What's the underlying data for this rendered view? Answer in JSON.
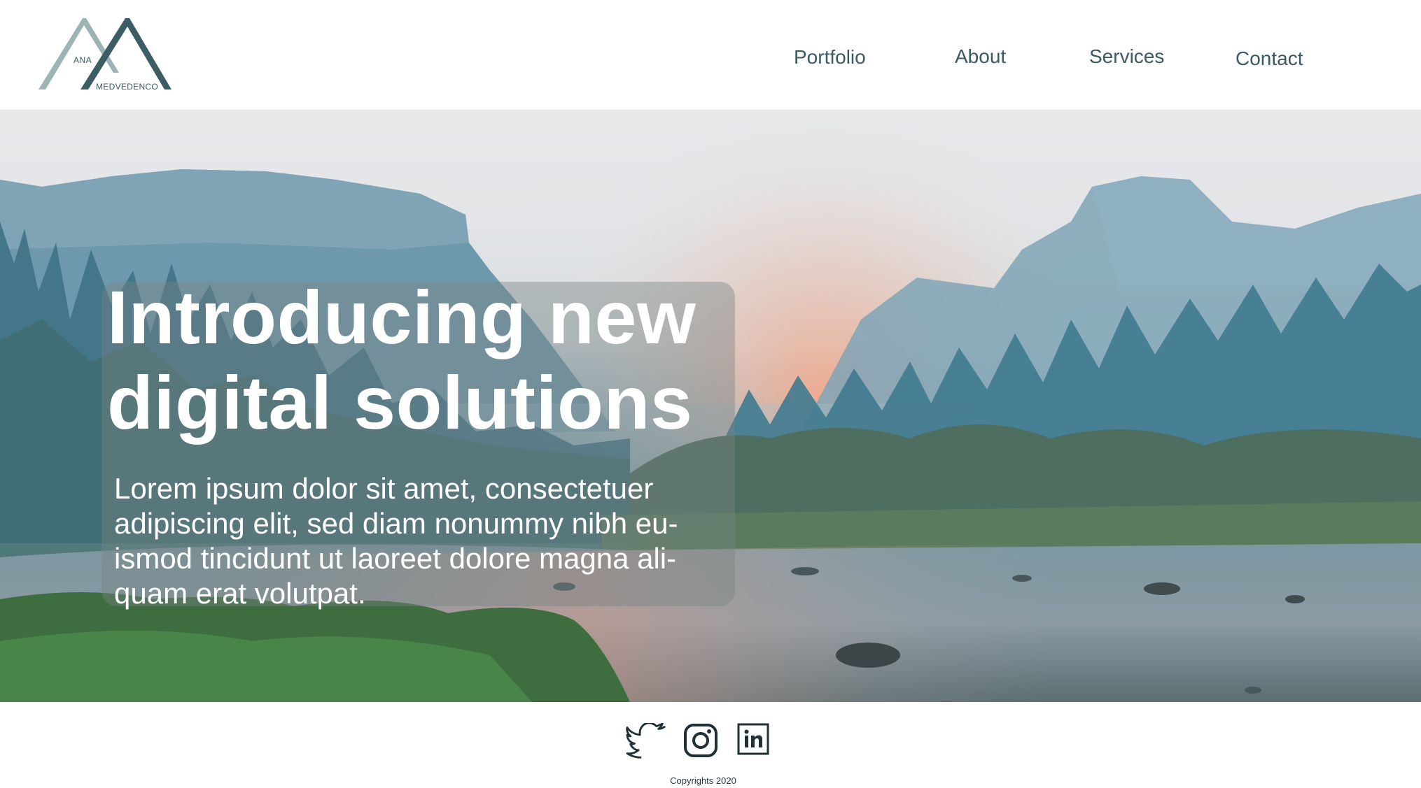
{
  "brand": {
    "logo_first": "ANA",
    "logo_last": "MEDVEDENCO",
    "colors": {
      "logo_light": "#9cb4b4",
      "logo_dark": "#3d5d64"
    }
  },
  "nav": {
    "items": [
      {
        "label": "Portfolio"
      },
      {
        "label": "About"
      },
      {
        "label": "Services"
      },
      {
        "label": "Contact"
      }
    ]
  },
  "hero": {
    "title_line1": "Introducing new",
    "title_line2": "digital solutions",
    "body": "Lorem ipsum dolor sit amet, consectetuer adipiscing elit, sed diam nonummy nibh eu- ismod tincidunt ut laoreet dolore magna ali- quam erat volutpat.",
    "background_image": "misty mountain river landscape at sunrise"
  },
  "footer": {
    "social": [
      {
        "icon": "twitter-icon"
      },
      {
        "icon": "instagram-icon"
      },
      {
        "icon": "linkedin-icon"
      }
    ],
    "copyright": "Copyrights 2020"
  },
  "colors": {
    "nav_text": "#3b5961",
    "icon_dark": "#1f3036",
    "hero_text": "#ffffff"
  }
}
